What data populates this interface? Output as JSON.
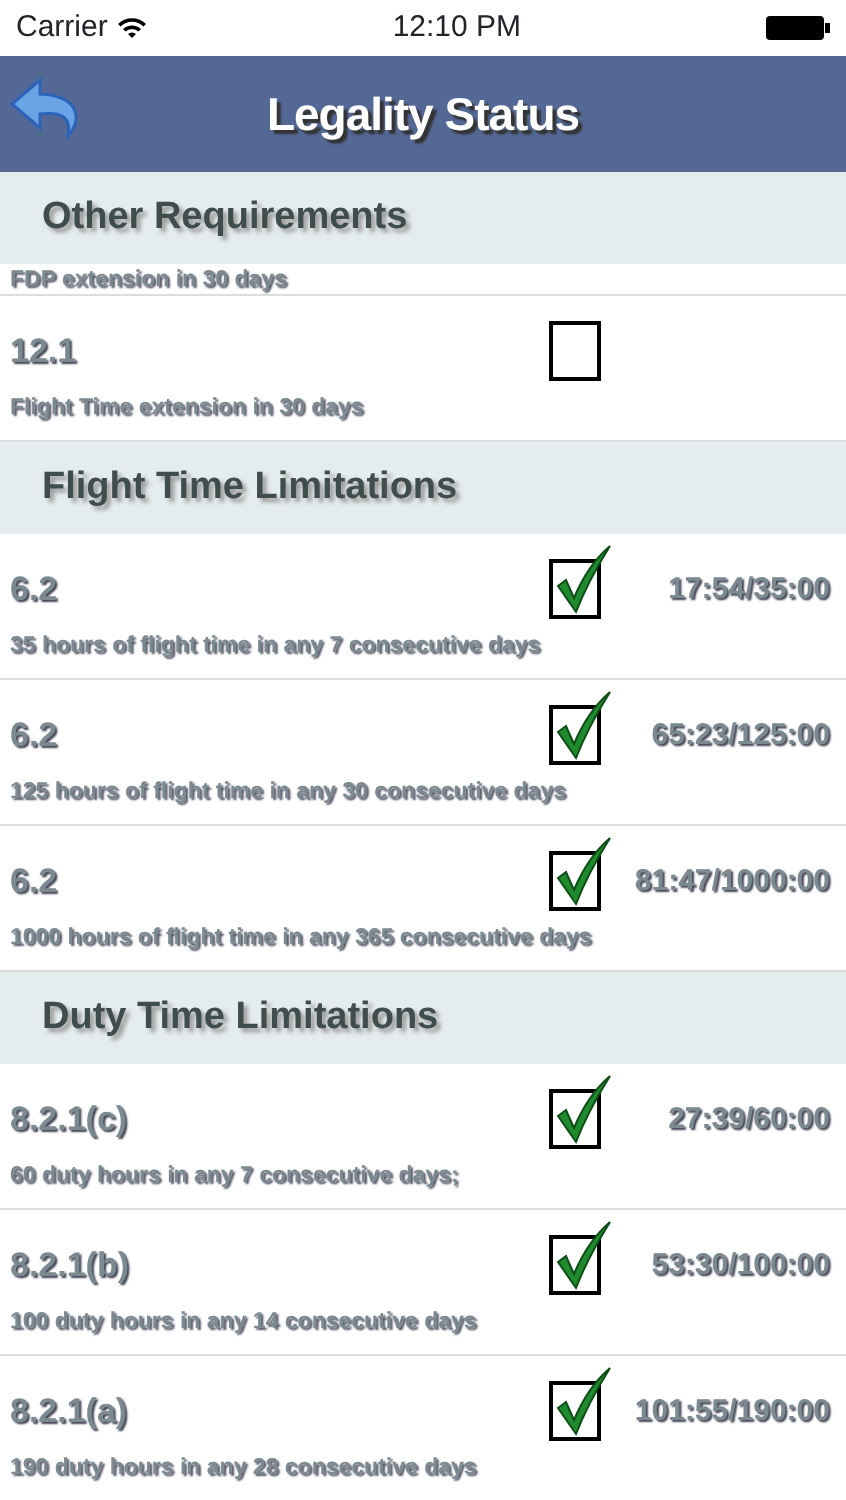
{
  "status_bar": {
    "carrier": "Carrier",
    "time": "12:10 PM"
  },
  "nav": {
    "title": "Legality Status"
  },
  "sections": [
    {
      "title": "Other Requirements",
      "rows": [
        {
          "kind": "clipped",
          "description": "FDP extension in 30 days"
        },
        {
          "kind": "row",
          "code": "12.1",
          "checked": false,
          "description": "Flight Time extension in 30 days"
        }
      ]
    },
    {
      "title": "Flight Time Limitations",
      "rows": [
        {
          "kind": "row",
          "code": "6.2",
          "checked": true,
          "value": "17:54/35:00",
          "description": "35 hours of flight time in any 7 consecutive days"
        },
        {
          "kind": "row",
          "code": "6.2",
          "checked": true,
          "value": "65:23/125:00",
          "description": "125 hours of flight time in any 30 consecutive days"
        },
        {
          "kind": "row",
          "code": "6.2",
          "checked": true,
          "value": "81:47/1000:00",
          "description": "1000 hours of flight time in any 365 consecutive days"
        }
      ]
    },
    {
      "title": "Duty Time Limitations",
      "rows": [
        {
          "kind": "row",
          "code": "8.2.1(c)",
          "checked": true,
          "value": "27:39/60:00",
          "description": "60 duty hours in any 7 consecutive days;"
        },
        {
          "kind": "row",
          "code": "8.2.1(b)",
          "checked": true,
          "value": "53:30/100:00",
          "description": "100 duty hours in any 14 consecutive days"
        },
        {
          "kind": "row",
          "code": "8.2.1(a)",
          "checked": true,
          "value": "101:55/190:00",
          "description": "190 duty hours in any 28 consecutive days"
        }
      ]
    }
  ]
}
